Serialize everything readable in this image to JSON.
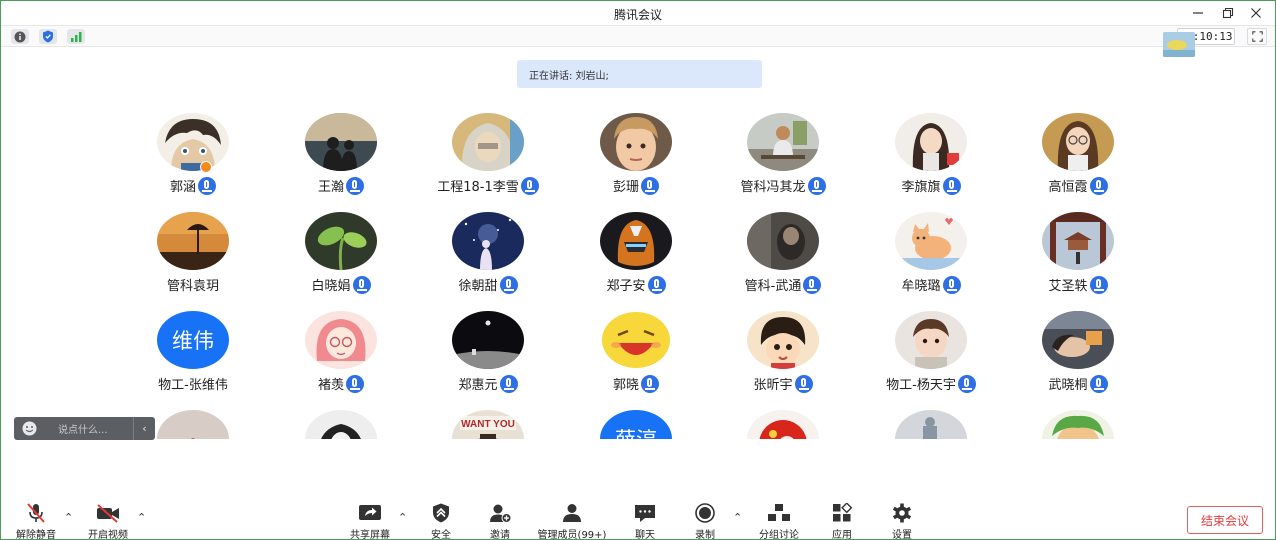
{
  "window": {
    "title": "腾讯会议"
  },
  "status": {
    "timer": "01:10:13"
  },
  "banner": {
    "speaking": "正在讲话: 刘岩山;"
  },
  "participants": [
    {
      "name": "郭涵",
      "avatar": "anime-boy",
      "mic": true,
      "host": true
    },
    {
      "name": "王瀚",
      "avatar": "sunset-couple",
      "mic": true
    },
    {
      "name": "工程18-1李雪",
      "avatar": "hooded-person",
      "mic": true
    },
    {
      "name": "彭珊",
      "avatar": "child-portrait",
      "mic": true
    },
    {
      "name": "管科冯其龙",
      "avatar": "person-on-bench",
      "mic": true
    },
    {
      "name": "李旗旗",
      "avatar": "girl-photo",
      "mic": true
    },
    {
      "name": "高恒霞",
      "avatar": "girl-glasses",
      "mic": true
    },
    {
      "name": "管科袁玥",
      "avatar": "dusk-tree",
      "mic": false
    },
    {
      "name": "白晓娟",
      "avatar": "green-sprout",
      "mic": true
    },
    {
      "name": "徐朝甜",
      "avatar": "starry-couple",
      "mic": true
    },
    {
      "name": "郑子安",
      "avatar": "robot-helmet",
      "mic": true
    },
    {
      "name": "管科-武通",
      "avatar": "dark-figure",
      "mic": true
    },
    {
      "name": "牟晓璐",
      "avatar": "cartoon-cat",
      "mic": true
    },
    {
      "name": "艾圣轶",
      "avatar": "temple-gate",
      "mic": true
    },
    {
      "name": "物工-张维伟",
      "avatar": "text",
      "avatar_text": "维伟",
      "mic": false
    },
    {
      "name": "褚羡",
      "avatar": "pink-girl-drawing",
      "mic": true
    },
    {
      "name": "郑惠元",
      "avatar": "moon-scene",
      "mic": true
    },
    {
      "name": "郭晓",
      "avatar": "laughing-emoji",
      "mic": true
    },
    {
      "name": "张昕宇",
      "avatar": "cartoon-face",
      "mic": true
    },
    {
      "name": "物工-杨天宇",
      "avatar": "toddler",
      "mic": true
    },
    {
      "name": "武晓桐",
      "avatar": "sleeping-person",
      "mic": true
    },
    {
      "name": "",
      "avatar": "pale-blur"
    },
    {
      "name": "",
      "avatar": "curly-hair-drawing"
    },
    {
      "name": "",
      "avatar": "sign-photo",
      "sign_text": "WANT YOU"
    },
    {
      "name": "",
      "avatar": "text",
      "avatar_text": "薛淳"
    },
    {
      "name": "",
      "avatar": "red-flag-figure"
    },
    {
      "name": "",
      "avatar": "gray-figure"
    },
    {
      "name": "",
      "avatar": "green-cartoon"
    }
  ],
  "chat": {
    "placeholder": "说点什么..."
  },
  "toolbar": {
    "unmute": "解除静音",
    "start_video": "开启视频",
    "share_screen": "共享屏幕",
    "security": "安全",
    "invite": "邀请",
    "manage_members": "管理成员(99+)",
    "chat": "聊天",
    "record": "录制",
    "breakout": "分组讨论",
    "apps": "应用",
    "settings": "设置",
    "end_meeting": "结束会议"
  }
}
